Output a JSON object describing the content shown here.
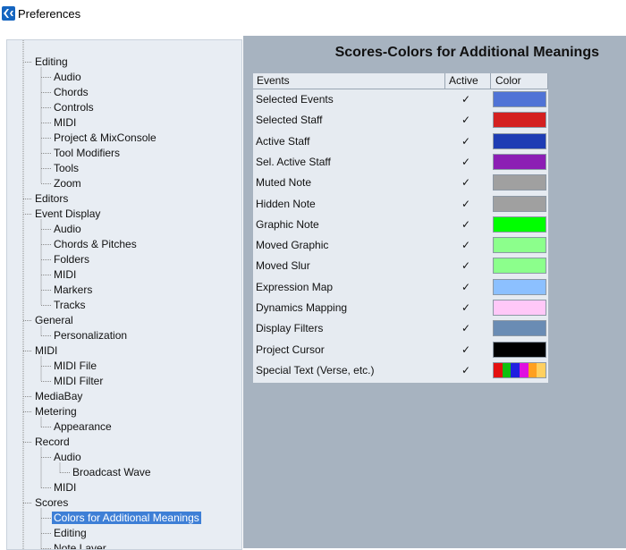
{
  "window": {
    "title": "Preferences"
  },
  "tree": {
    "items": [
      {
        "label": "Editing",
        "level": 0
      },
      {
        "label": "Audio",
        "level": 1
      },
      {
        "label": "Chords",
        "level": 1
      },
      {
        "label": "Controls",
        "level": 1
      },
      {
        "label": "MIDI",
        "level": 1
      },
      {
        "label": "Project & MixConsole",
        "level": 1
      },
      {
        "label": "Tool Modifiers",
        "level": 1
      },
      {
        "label": "Tools",
        "level": 1
      },
      {
        "label": "Zoom",
        "level": 1
      },
      {
        "label": "Editors",
        "level": 0
      },
      {
        "label": "Event Display",
        "level": 0
      },
      {
        "label": "Audio",
        "level": 1
      },
      {
        "label": "Chords & Pitches",
        "level": 1
      },
      {
        "label": "Folders",
        "level": 1
      },
      {
        "label": "MIDI",
        "level": 1
      },
      {
        "label": "Markers",
        "level": 1
      },
      {
        "label": "Tracks",
        "level": 1
      },
      {
        "label": "General",
        "level": 0
      },
      {
        "label": "Personalization",
        "level": 1
      },
      {
        "label": "MIDI",
        "level": 0
      },
      {
        "label": "MIDI File",
        "level": 1
      },
      {
        "label": "MIDI Filter",
        "level": 1
      },
      {
        "label": "MediaBay",
        "level": 0
      },
      {
        "label": "Metering",
        "level": 0
      },
      {
        "label": "Appearance",
        "level": 1
      },
      {
        "label": "Record",
        "level": 0
      },
      {
        "label": "Audio",
        "level": 1
      },
      {
        "label": "Broadcast Wave",
        "level": 2
      },
      {
        "label": "MIDI",
        "level": 1
      },
      {
        "label": "Scores",
        "level": 0
      },
      {
        "label": "Colors for Additional Meanings",
        "level": 1,
        "selected": true
      },
      {
        "label": "Editing",
        "level": 1
      },
      {
        "label": "Note Layer",
        "level": 1
      }
    ]
  },
  "page": {
    "title": "Scores-Colors for Additional Meanings"
  },
  "table": {
    "headers": {
      "events": "Events",
      "active": "Active",
      "color": "Color"
    },
    "check_glyph": "✓",
    "rows": [
      {
        "event": "Selected Events",
        "active": true,
        "color": "#5073d6"
      },
      {
        "event": "Selected Staff",
        "active": true,
        "color": "#d42020"
      },
      {
        "event": "Active Staff",
        "active": true,
        "color": "#1e3cb4"
      },
      {
        "event": "Sel. Active Staff",
        "active": true,
        "color": "#8c1eb4"
      },
      {
        "event": "Muted Note",
        "active": true,
        "color": "#a0a0a0"
      },
      {
        "event": "Hidden Note",
        "active": true,
        "color": "#a0a0a0"
      },
      {
        "event": "Graphic Note",
        "active": true,
        "color": "#00ff00"
      },
      {
        "event": "Moved Graphic",
        "active": true,
        "color": "#8cff8c"
      },
      {
        "event": "Moved Slur",
        "active": true,
        "color": "#8cff8c"
      },
      {
        "event": "Expression Map",
        "active": true,
        "color": "#8cc0ff"
      },
      {
        "event": "Dynamics Mapping",
        "active": true,
        "color": "#ffc8f8"
      },
      {
        "event": "Display Filters",
        "active": true,
        "color": "#6a8cb4"
      },
      {
        "event": "Project Cursor",
        "active": true,
        "color": "#000000"
      },
      {
        "event": "Special Text (Verse, etc.)",
        "active": true,
        "color": "multi",
        "colors": [
          "#e41010",
          "#10c010",
          "#2020e0",
          "#e010e0",
          "#ffa020",
          "#ffd060"
        ]
      }
    ]
  },
  "colors": {
    "selection": "#3e7fd6",
    "panel": "#a7b3c0",
    "tree_bg": "#e8edf3"
  }
}
